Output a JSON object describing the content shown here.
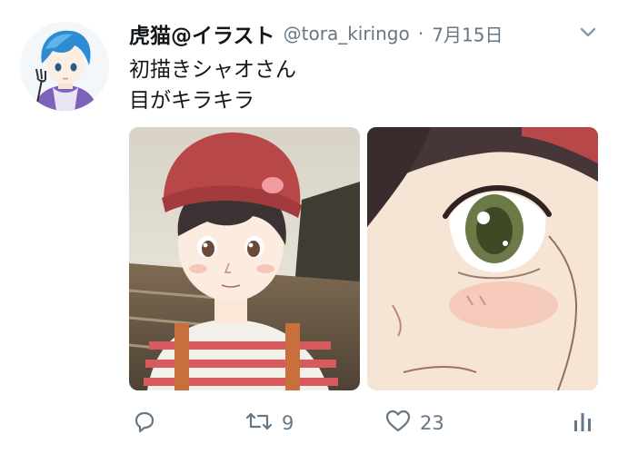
{
  "tweet": {
    "display_name": "虎猫@イラスト",
    "handle": "@tora_kiringo",
    "separator": "·",
    "timestamp": "7月15日",
    "text_line1": "初描きシャオさん",
    "text_line2": "目がキラキラ",
    "actions": {
      "retweet_count": "9",
      "like_count": "23"
    }
  },
  "icons": {
    "chevron": "chevron-down-icon",
    "reply": "reply-icon",
    "retweet": "retweet-icon",
    "like": "heart-icon",
    "analytics": "analytics-icon"
  },
  "colors": {
    "text": "#14171a",
    "secondary": "#657786",
    "background": "#ffffff"
  }
}
